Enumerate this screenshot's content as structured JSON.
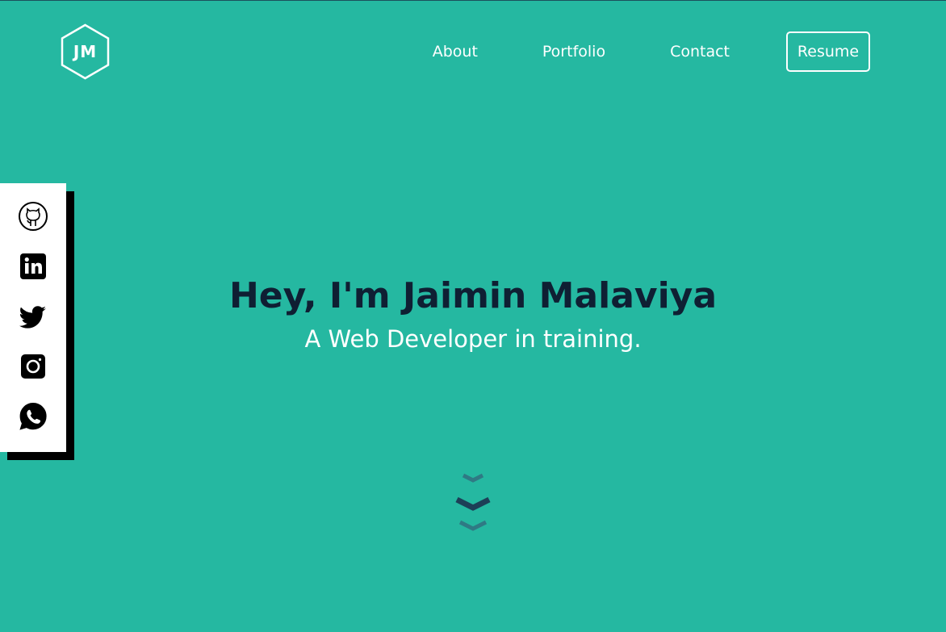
{
  "logo": {
    "text": "JM",
    "color": "#ffffff"
  },
  "nav": {
    "links": [
      "About",
      "Portfolio",
      "Contact"
    ],
    "resume_label": "Resume"
  },
  "social": {
    "icons": [
      "github-icon",
      "linkedin-icon",
      "twitter-icon",
      "instagram-icon",
      "whatsapp-icon"
    ]
  },
  "hero": {
    "title": "Hey, I'm Jaimin Malaviya",
    "subtitle": "A Web Developer in training."
  },
  "colors": {
    "background": "#25b8a1",
    "title": "#0f1f33",
    "text": "#ffffff",
    "chevron_dark": "#1d3f57",
    "chevron_light": "#2f7a84"
  }
}
